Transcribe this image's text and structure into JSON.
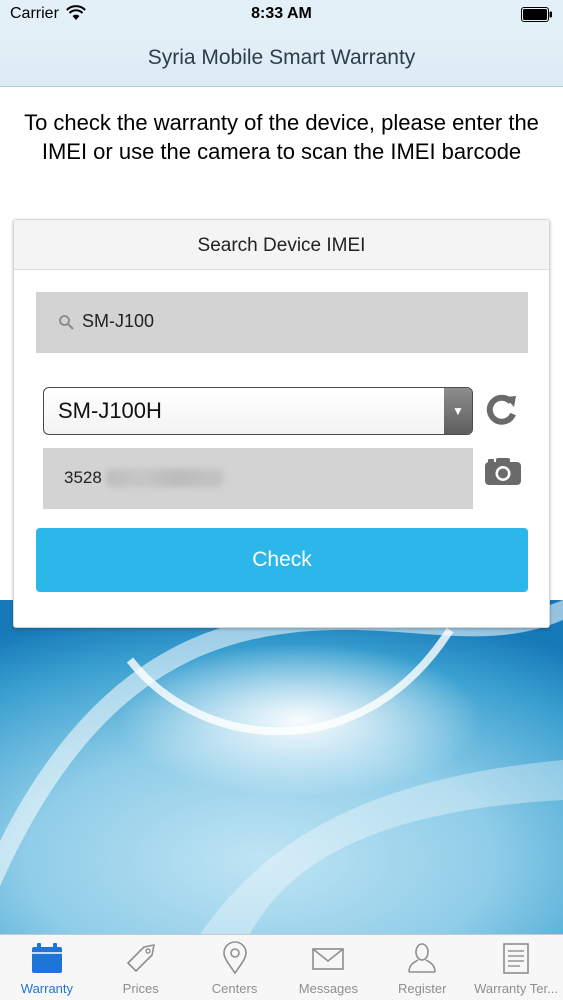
{
  "status_bar": {
    "carrier": "Carrier",
    "time": "8:33 AM",
    "icons": [
      "wifi-icon",
      "battery-icon"
    ]
  },
  "nav": {
    "title": "Syria Mobile Smart Warranty"
  },
  "instruction": "To check the warranty of the device, please enter the IMEI or use the camera to scan the IMEI barcode",
  "card": {
    "header": "Search Device IMEI",
    "search": {
      "value": "SM-J100",
      "icon": "search-icon"
    },
    "model_select": {
      "selected": "SM-J100H",
      "icon": "chevron-down-icon"
    },
    "refresh_icon": "refresh-icon",
    "imei": {
      "visible_value": "3528",
      "blurred": true
    },
    "camera_icon": "camera-icon",
    "check_label": "Check"
  },
  "tabs": [
    {
      "label": "Warranty",
      "icon": "calendar-icon",
      "active": true
    },
    {
      "label": "Prices",
      "icon": "price-tag-icon",
      "active": false
    },
    {
      "label": "Centers",
      "icon": "location-pin-icon",
      "active": false
    },
    {
      "label": "Messages",
      "icon": "envelope-icon",
      "active": false
    },
    {
      "label": "Register",
      "icon": "user-icon",
      "active": false
    },
    {
      "label": "Warranty Ter...",
      "icon": "document-icon",
      "active": false
    }
  ],
  "colors": {
    "accent": "#2cb7ea",
    "active_tab": "#1f74d8",
    "inactive_tab": "#8e8e93",
    "header_bg": "#e4f0f7"
  }
}
